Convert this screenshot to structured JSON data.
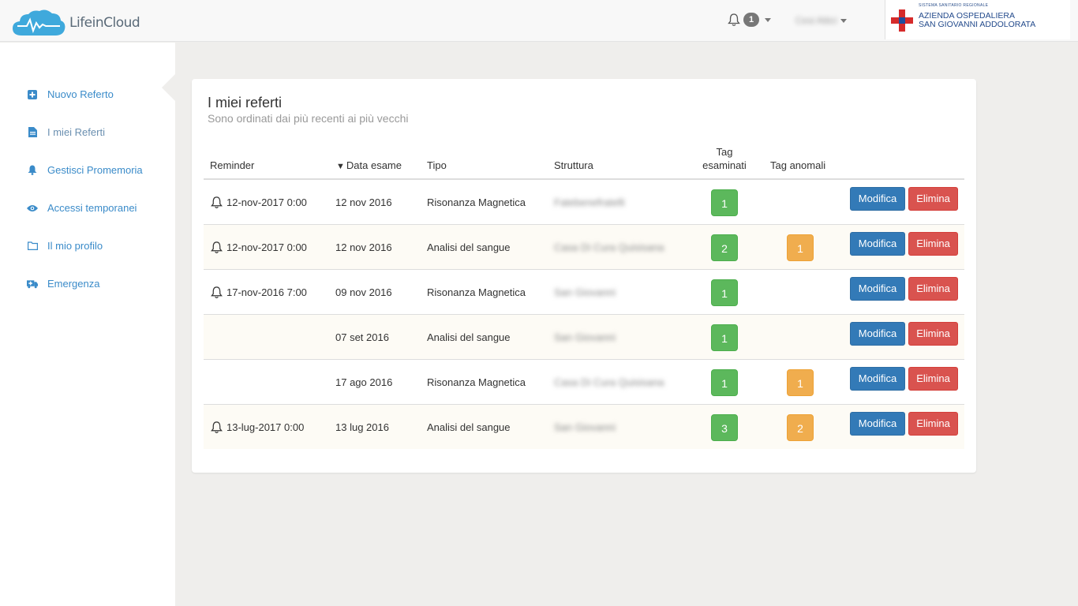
{
  "brand": {
    "name": "LifeinCloud"
  },
  "header": {
    "notification_count": "1",
    "user_name": "Cesi Attici",
    "hospital": {
      "small_text": "SISTEMA SANITARIO REGIONALE",
      "line1": "AZIENDA OSPEDALIERA",
      "line2": "SAN GIOVANNI ADDOLORATA"
    }
  },
  "sidebar": {
    "items": [
      {
        "label": "Nuovo Referto",
        "icon": "plus-square-icon"
      },
      {
        "label": "I miei Referti",
        "icon": "file-icon"
      },
      {
        "label": "Gestisci Promemoria",
        "icon": "bell-icon"
      },
      {
        "label": "Accessi temporanei",
        "icon": "eye-icon"
      },
      {
        "label": "Il mio profilo",
        "icon": "folder-icon"
      },
      {
        "label": "Emergenza",
        "icon": "ambulance-icon"
      }
    ]
  },
  "panel": {
    "title": "I miei referti",
    "subtitle": "Sono ordinati dai più recenti ai più vecchi",
    "columns": {
      "reminder": "Reminder",
      "sort_arrow": "▼",
      "date": "Data esame",
      "type": "Tipo",
      "structure": "Struttura",
      "tag_exam_1": "Tag",
      "tag_exam_2": "esaminati",
      "tag_anom": "Tag anomali"
    },
    "edit_label": "Modifica",
    "delete_label": "Elimina",
    "rows": [
      {
        "reminder": "12-nov-2017 0:00",
        "date": "12 nov 2016",
        "type": "Risonanza Magnetica",
        "structure": "Fatebenefratelli",
        "tags": "1",
        "anom": ""
      },
      {
        "reminder": "12-nov-2017 0:00",
        "date": "12 nov 2016",
        "type": "Analisi del sangue",
        "structure": "Casa Di Cura Quisisana",
        "tags": "2",
        "anom": "1"
      },
      {
        "reminder": "17-nov-2016 7:00",
        "date": "09 nov 2016",
        "type": "Risonanza Magnetica",
        "structure": "San Giovanni",
        "tags": "1",
        "anom": ""
      },
      {
        "reminder": "",
        "date": "07 set 2016",
        "type": "Analisi del sangue",
        "structure": "San Giovanni",
        "tags": "1",
        "anom": ""
      },
      {
        "reminder": "",
        "date": "17 ago 2016",
        "type": "Risonanza Magnetica",
        "structure": "Casa Di Cura Quisisana",
        "tags": "1",
        "anom": "1"
      },
      {
        "reminder": "13-lug-2017 0:00",
        "date": "13 lug 2016",
        "type": "Analisi del sangue",
        "structure": "San Giovanni",
        "tags": "3",
        "anom": "2"
      }
    ]
  }
}
